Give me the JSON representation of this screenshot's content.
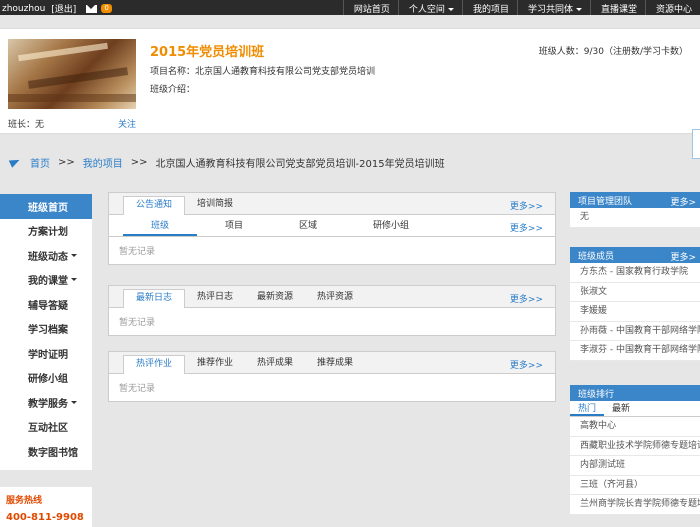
{
  "topbar": {
    "username": "zhouzhou",
    "logout": "[退出]",
    "mail_count": "0",
    "nav": [
      {
        "label": "网站首页",
        "caret": false
      },
      {
        "label": "个人空间",
        "caret": true
      },
      {
        "label": "我的项目",
        "caret": false
      },
      {
        "label": "学习共同体",
        "caret": true
      },
      {
        "label": "直播课堂",
        "caret": false
      },
      {
        "label": "资源中心",
        "caret": false
      }
    ]
  },
  "class_info": {
    "title": "2015年党员培训班",
    "project_name": "项目名称：北京国人通教育科技有限公司党支部党员培训",
    "intro": "班级介绍：",
    "monitor": "班长：无",
    "follow": "关注",
    "count": "班级人数：9/30（注册数/学习卡数）"
  },
  "breadcrumb": {
    "home": "首页",
    "my_projects": "我的项目",
    "current": "北京国人通教育科技有限公司党支部党员培训-2015年党员培训班",
    "sep": ">>"
  },
  "left_menu": {
    "items": [
      {
        "label": "班级首页",
        "active": true,
        "caret": false
      },
      {
        "label": "方案计划",
        "active": false,
        "caret": false
      },
      {
        "label": "班级动态",
        "active": false,
        "caret": true
      },
      {
        "label": "我的课堂",
        "active": false,
        "caret": true
      },
      {
        "label": "辅导答疑",
        "active": false,
        "caret": false
      },
      {
        "label": "学习档案",
        "active": false,
        "caret": false
      },
      {
        "label": "学时证明",
        "active": false,
        "caret": false
      },
      {
        "label": "研修小组",
        "active": false,
        "caret": false
      },
      {
        "label": "教学服务",
        "active": false,
        "caret": true
      },
      {
        "label": "互动社区",
        "active": false,
        "caret": false
      },
      {
        "label": "数字图书馆",
        "active": false,
        "caret": false
      }
    ],
    "hotline_title": "服务热线",
    "hotline_number": "400-811-9908"
  },
  "panels": {
    "notice": {
      "tabs": [
        "公告通知",
        "培训简报"
      ],
      "subtabs": [
        "班级",
        "项目",
        "区域",
        "研修小组"
      ],
      "more": "更多>>",
      "empty": "暂无记录"
    },
    "logs": {
      "tabs": [
        "最新日志",
        "热评日志",
        "最新资源",
        "热评资源"
      ],
      "more": "更多>>",
      "empty": "暂无记录"
    },
    "works": {
      "tabs": [
        "热评作业",
        "推荐作业",
        "热评成果",
        "推荐成果"
      ],
      "more": "更多>>",
      "empty": "暂无记录"
    }
  },
  "right": {
    "team": {
      "title": "项目管理团队",
      "more": "更多>",
      "items": [
        "无"
      ]
    },
    "members": {
      "title": "班级成员",
      "more": "更多>",
      "items": [
        "方东杰 - 国家教育行政学院",
        "张淑文",
        "李媛媛",
        "孙雨薇 - 中国教育干部网络学院",
        "李淑芬 - 中国教育干部网络学院"
      ]
    },
    "ranking": {
      "title": "班级排行",
      "tabs": [
        "热门",
        "最新"
      ],
      "items": [
        "高教中心",
        "西藏职业技术学院师德专题培训",
        "内部测试班",
        "三班（齐河县）",
        "兰州商学院长青学院师德专题培训"
      ]
    }
  },
  "colors": {
    "accent_blue": "#3b86c9",
    "link_blue": "#2a7cc7",
    "title_orange": "#f08c00",
    "hotline_red": "#e04a00"
  }
}
